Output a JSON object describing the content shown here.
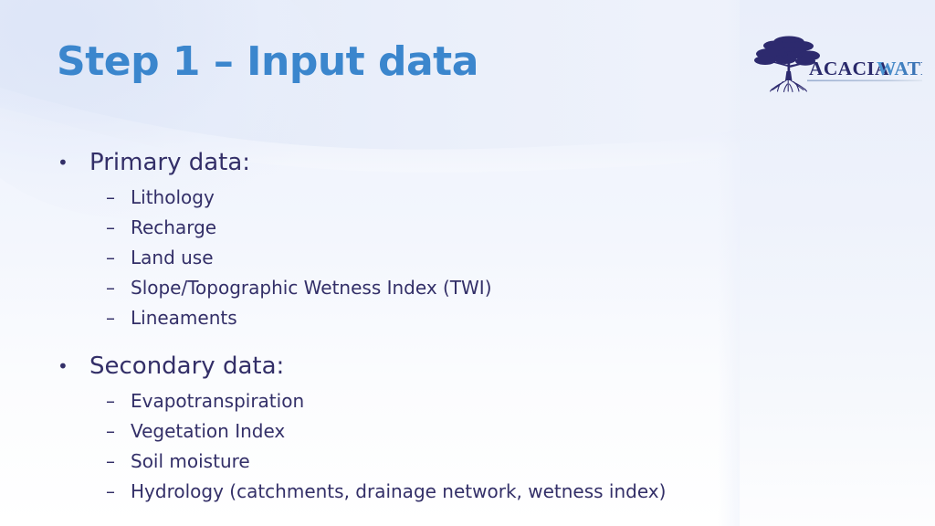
{
  "slide": {
    "title": "Step 1 – Input data",
    "background": {
      "top_tint": "#eef2fc",
      "corner_tint": "#dde5f8",
      "right_panel_tint": "#e9eefa",
      "base": "#ffffff"
    },
    "title_color": "#3b86cd",
    "body_text_color": "#332f68"
  },
  "logo": {
    "name": "acacia-water-logo",
    "tree_icon": "acacia-tree-icon",
    "word_primary": "ACACIA",
    "word_secondary": "WATER",
    "word_primary_color": "#2a2a6b",
    "word_secondary_gradient_from": "#4f9ad6",
    "word_secondary_gradient_to": "#22356f",
    "tree_color": "#2d2a6e",
    "underline_color": "#8fa4c9"
  },
  "content": {
    "bullet_marker_level1": "•",
    "bullet_marker_level2": "–",
    "groups": [
      {
        "heading": "Primary data:",
        "items": [
          "Lithology",
          "Recharge",
          "Land use",
          "Slope/Topographic Wetness Index (TWI)",
          "Lineaments"
        ]
      },
      {
        "heading": "Secondary data:",
        "items": [
          "Evapotranspiration",
          "Vegetation Index",
          "Soil moisture",
          "Hydrology (catchments, drainage network, wetness index)"
        ]
      }
    ]
  }
}
